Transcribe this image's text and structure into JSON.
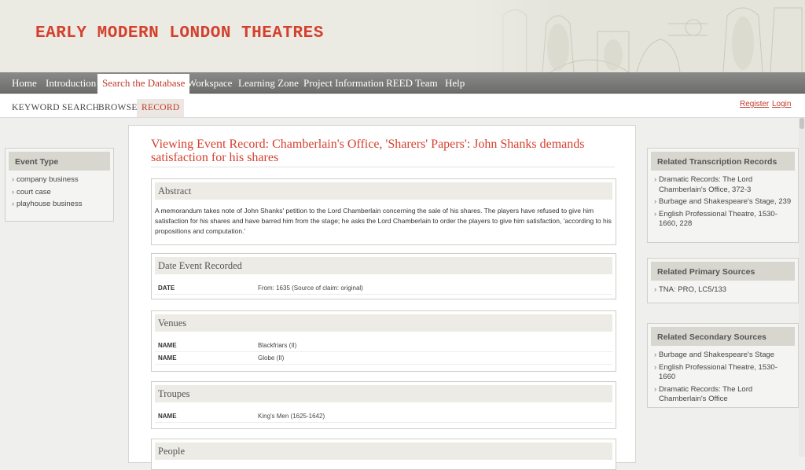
{
  "site": {
    "title": "EARLY MODERN LONDON THEATRES"
  },
  "nav": {
    "tabs": [
      {
        "label": "Home"
      },
      {
        "label": "Introduction"
      },
      {
        "label": "Search the Database",
        "active": true
      },
      {
        "label": "Workspace"
      },
      {
        "label": "Learning Zone"
      },
      {
        "label": "Project Information"
      },
      {
        "label": "REED Team"
      },
      {
        "label": "Help"
      }
    ]
  },
  "subnav": {
    "tabs": [
      {
        "label": "KEYWORD SEARCH"
      },
      {
        "label": "BROWSE"
      },
      {
        "label": "RECORD",
        "active": true
      }
    ],
    "register": "Register",
    "login": "Login"
  },
  "event_type": {
    "heading": "Event Type",
    "items": [
      "company business",
      "court case",
      "playhouse business"
    ]
  },
  "record": {
    "title": "Viewing Event Record: Chamberlain's Office, 'Sharers' Papers': John Shanks demands satisfaction for his shares",
    "abstract": {
      "heading": "Abstract",
      "text": "A memorandum takes note of John Shanks' petition to the Lord Chamberlain concerning the sale of his shares. The players have refused to give him satisfaction for his shares and have barred him from the stage; he asks the Lord Chamberlain to order the players to give him satisfaction, 'according to his propositions and computation.'"
    },
    "date_recorded": {
      "heading": "Date Event Recorded",
      "rows": [
        {
          "label": "DATE",
          "value": "From: 1635 (Source of claim: original)"
        }
      ]
    },
    "venues": {
      "heading": "Venues",
      "rows": [
        {
          "label": "NAME",
          "value": "Blackfriars (II)"
        },
        {
          "label": "NAME",
          "value": "Globe (II)"
        }
      ]
    },
    "troupes": {
      "heading": "Troupes",
      "rows": [
        {
          "label": "NAME",
          "value": "King's Men (1625-1642)"
        }
      ]
    },
    "people": {
      "heading": "People"
    }
  },
  "related_transcription": {
    "heading": "Related Transcription Records",
    "items": [
      "Dramatic Records: The Lord Chamberlain's Office, 372-3",
      "Burbage and Shakespeare's Stage, 239",
      "English Professional Theatre, 1530-1660, 228"
    ]
  },
  "related_primary": {
    "heading": "Related Primary Sources",
    "items": [
      "TNA: PRO, LC5/133"
    ]
  },
  "related_secondary": {
    "heading": "Related Secondary Sources",
    "items": [
      "Burbage and Shakespeare's Stage",
      "English Professional Theatre, 1530-1660",
      "Dramatic Records: The Lord Chamberlain's Office"
    ]
  },
  "colors": {
    "accent": "#d4402e",
    "nav_bg": "#777775",
    "box_header": "#d7d7cf"
  }
}
